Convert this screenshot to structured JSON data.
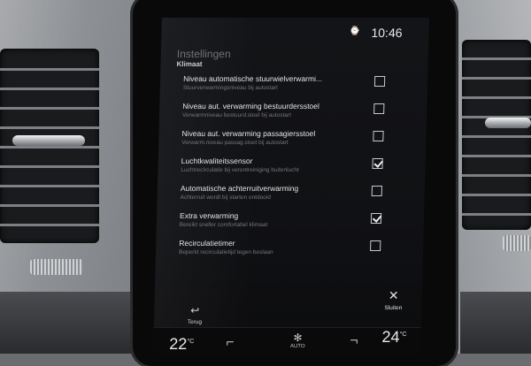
{
  "status_bar": {
    "time": "10:46",
    "clock_icon": "clock-icon"
  },
  "header": {
    "title": "Instellingen",
    "subtitle": "Klimaat"
  },
  "settings": [
    {
      "title": "Niveau automatische stuurwielverwarmi...",
      "description": "Stuurverwarmingsniveau bij autostart",
      "checked": false
    },
    {
      "title": "Niveau aut. verwarming bestuurdersstoel",
      "description": "Verwarmniveau bestuurd.stoel bij autostart",
      "checked": false
    },
    {
      "title": "Niveau aut. verwarming passagiersstoel",
      "description": "Verwarm.niveau passag.stoel bij autostart",
      "checked": false
    },
    {
      "title": "Luchtkwaliteitssensor",
      "description": "Luchtrecirculatie bij verontreiniging buitenlucht",
      "checked": true
    },
    {
      "title": "Automatische achterruitverwarming",
      "description": "Achterruit wordt bij starten ontdooid",
      "checked": false
    },
    {
      "title": "Extra verwarming",
      "description": "Bereikt sneller comfortabel klimaat",
      "checked": true
    },
    {
      "title": "Recirculatietimer",
      "description": "Beperkt recirculatietijd tegen beslaan",
      "checked": false
    }
  ],
  "footer": {
    "back_label": "Terug",
    "back_icon": "return-arrow-icon",
    "close_label": "Sluiten",
    "close_icon": "close-icon"
  },
  "climate": {
    "temp_left": "22",
    "temp_right": "24",
    "unit": "°C",
    "fan_label": "AUTO",
    "seat_left_icon": "seat-heat-left-icon",
    "seat_right_icon": "seat-heat-right-icon",
    "fan_icon": "fan-icon"
  }
}
